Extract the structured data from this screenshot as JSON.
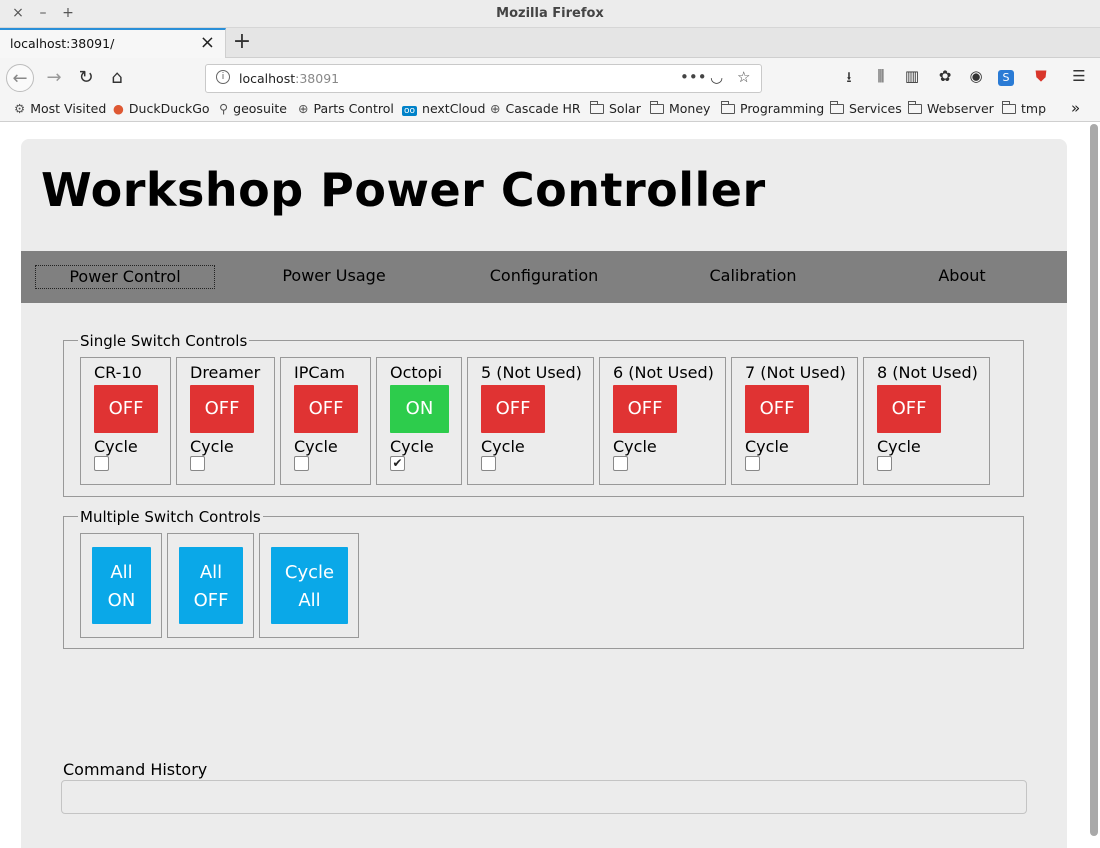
{
  "window": {
    "title": "Mozilla Firefox",
    "controls": [
      "×",
      "–",
      "+"
    ]
  },
  "tab": {
    "label": "localhost:38091/",
    "close": "×",
    "new_tab": "+"
  },
  "navbar": {
    "url_host": "localhost",
    "url_port": ":38091",
    "icons": [
      "back-icon",
      "forward-icon",
      "reload-icon",
      "home-icon",
      "info-icon",
      "page-actions-icon",
      "pocket-icon",
      "bookmark-star-icon",
      "reader-icon",
      "library-icon",
      "sidebar-icon",
      "gnome-icon",
      "account-icon",
      "extension-s-icon",
      "shield-icon",
      "menu-icon"
    ]
  },
  "bookmarks": [
    {
      "label": "Most Visited",
      "icon": "gear-icon"
    },
    {
      "label": "DuckDuckGo",
      "icon": "duck-icon"
    },
    {
      "label": "geosuite",
      "icon": "geo-icon"
    },
    {
      "label": "Parts Control",
      "icon": "globe-icon"
    },
    {
      "label": "nextCloud",
      "icon": "nextcloud-icon"
    },
    {
      "label": "Cascade HR",
      "icon": "globe-icon"
    },
    {
      "label": "Solar",
      "icon": "folder-icon"
    },
    {
      "label": "Money",
      "icon": "folder-icon"
    },
    {
      "label": "Programming",
      "icon": "folder-icon"
    },
    {
      "label": "Services",
      "icon": "folder-icon"
    },
    {
      "label": "Webserver",
      "icon": "folder-icon"
    },
    {
      "label": "tmp",
      "icon": "folder-icon"
    }
  ],
  "page": {
    "title": "Workshop Power Controller",
    "menu": [
      {
        "label": "Power Control",
        "active": true
      },
      {
        "label": "Power Usage"
      },
      {
        "label": "Configuration"
      },
      {
        "label": "Calibration"
      },
      {
        "label": "About"
      }
    ],
    "single": {
      "legend": "Single Switch Controls",
      "cycle_label": "Cycle",
      "switches": [
        {
          "name": "CR-10",
          "state": "OFF",
          "cycle_checked": false
        },
        {
          "name": "Dreamer",
          "state": "OFF",
          "cycle_checked": false
        },
        {
          "name": "IPCam",
          "state": "OFF",
          "cycle_checked": false
        },
        {
          "name": "Octopi",
          "state": "ON",
          "cycle_checked": true
        },
        {
          "name": "5 (Not Used)",
          "state": "OFF",
          "cycle_checked": false
        },
        {
          "name": "6 (Not Used)",
          "state": "OFF",
          "cycle_checked": false
        },
        {
          "name": "7 (Not Used)",
          "state": "OFF",
          "cycle_checked": false
        },
        {
          "name": "8 (Not Used)",
          "state": "OFF",
          "cycle_checked": false
        }
      ]
    },
    "multiple": {
      "legend": "Multiple Switch Controls",
      "buttons": [
        {
          "line1": "All",
          "line2": "ON"
        },
        {
          "line1": "All",
          "line2": "OFF"
        },
        {
          "line1": "Cycle",
          "line2": "All"
        }
      ]
    },
    "history": {
      "label": "Command History",
      "value": ""
    }
  },
  "colors": {
    "off": "#e03333",
    "on": "#2dcc4c",
    "multi": "#0aa8e8",
    "menu_bar": "#808080",
    "panel": "#ececec"
  }
}
